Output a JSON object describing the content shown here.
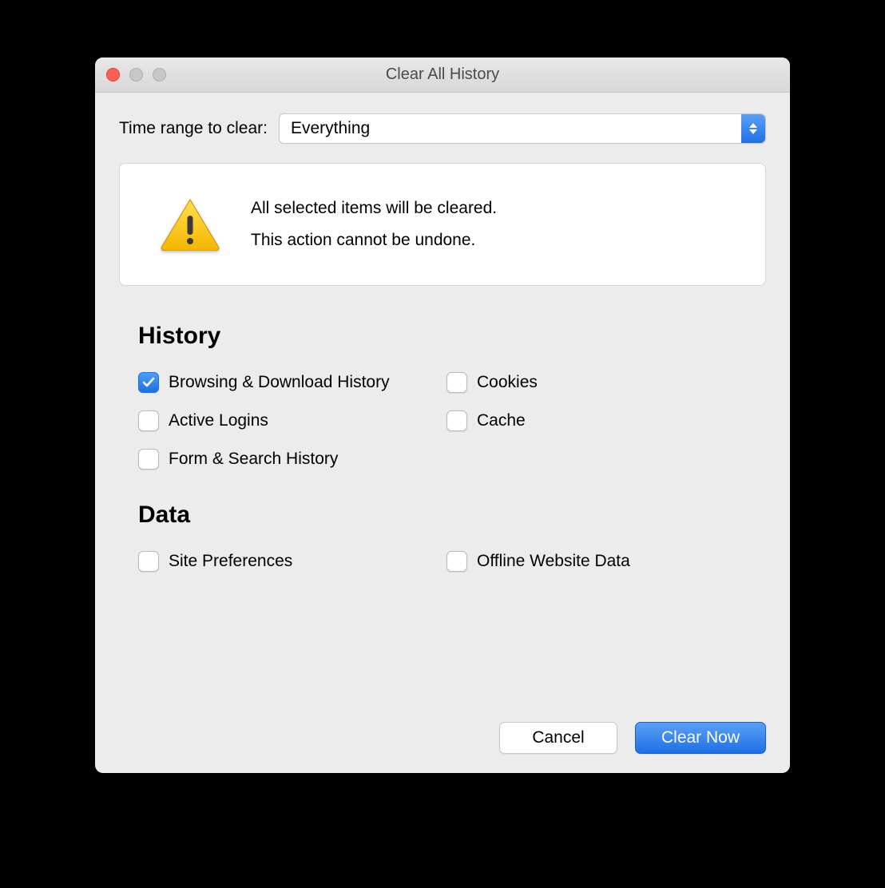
{
  "window": {
    "title": "Clear All History"
  },
  "time": {
    "label": "Time range to clear:",
    "value": "Everything"
  },
  "warning": {
    "line1": "All selected items will be cleared.",
    "line2": "This action cannot be undone."
  },
  "sections": {
    "history": {
      "heading": "History",
      "items": [
        {
          "label": "Browsing & Download History",
          "checked": true
        },
        {
          "label": "Cookies",
          "checked": false
        },
        {
          "label": "Active Logins",
          "checked": false
        },
        {
          "label": "Cache",
          "checked": false
        },
        {
          "label": "Form & Search History",
          "checked": false
        }
      ]
    },
    "data": {
      "heading": "Data",
      "items": [
        {
          "label": "Site Preferences",
          "checked": false
        },
        {
          "label": "Offline Website Data",
          "checked": false
        }
      ]
    }
  },
  "buttons": {
    "cancel": "Cancel",
    "confirm": "Clear Now"
  },
  "colors": {
    "accent": "#2576e8"
  }
}
